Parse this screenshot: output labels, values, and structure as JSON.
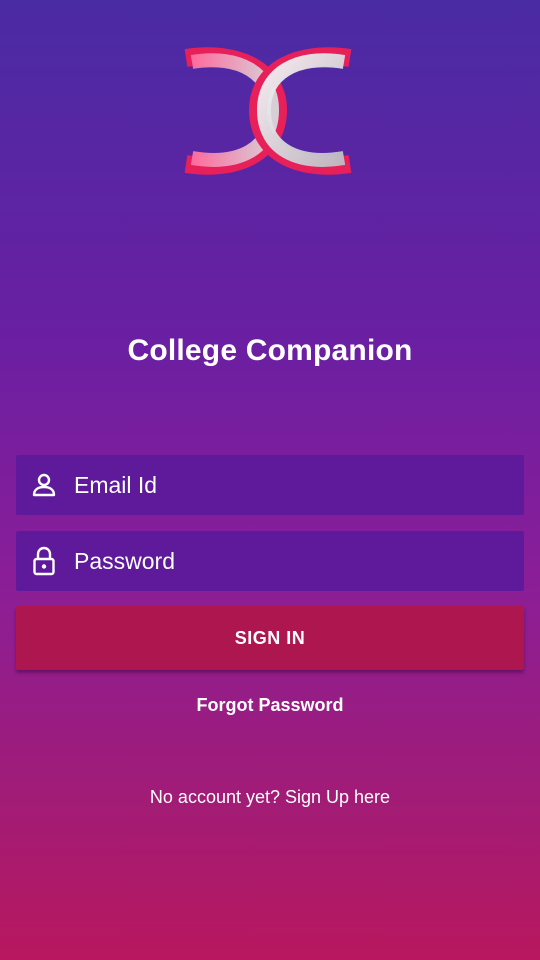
{
  "app": {
    "title": "College Companion"
  },
  "login_form": {
    "email": {
      "placeholder": "Email Id",
      "value": "",
      "icon": "person-icon"
    },
    "password": {
      "placeholder": "Password",
      "value": "",
      "icon": "lock-icon"
    },
    "sign_in_label": "SIGN IN",
    "forgot_password_label": "Forgot Password",
    "signup_label": "No account yet? Sign Up here"
  },
  "colors": {
    "background_top": "#4A2BA4",
    "background_bottom": "#B8185E",
    "field_background": "#5E1A9A",
    "button_background": "#AE1650",
    "text": "#FFFFFF"
  },
  "logo": {
    "icon": "app-logo-icon"
  }
}
